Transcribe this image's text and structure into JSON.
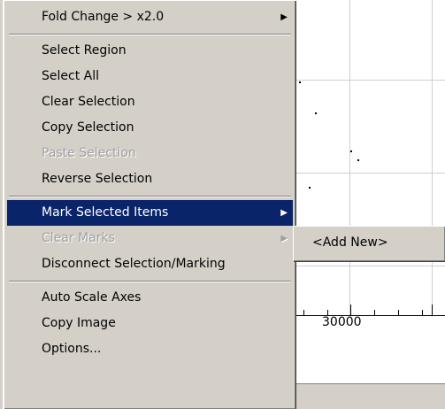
{
  "menu": {
    "items": [
      {
        "label": "Fold Change > x2.0",
        "has_submenu": true,
        "disabled": false
      },
      {
        "separator": true
      },
      {
        "label": "Select Region",
        "disabled": false
      },
      {
        "label": "Select All",
        "disabled": false
      },
      {
        "label": "Clear Selection",
        "disabled": false
      },
      {
        "label": "Copy Selection",
        "disabled": false
      },
      {
        "label": "Paste Selection",
        "disabled": true
      },
      {
        "label": "Reverse Selection",
        "disabled": false
      },
      {
        "separator": true
      },
      {
        "label": "Mark Selected Items",
        "has_submenu": true,
        "selected": true
      },
      {
        "label": "Clear Marks",
        "has_submenu": true,
        "disabled": true
      },
      {
        "label": "Disconnect Selection/Marking",
        "disabled": false
      },
      {
        "separator": true
      },
      {
        "label": "Auto Scale Axes",
        "disabled": false
      },
      {
        "label": "Copy Image",
        "disabled": false
      },
      {
        "label": "Options...",
        "disabled": false
      }
    ]
  },
  "submenu": {
    "items": [
      {
        "label": "<Add New>"
      }
    ]
  },
  "plot": {
    "x_tick_label": "30000"
  },
  "colors": {
    "menu_bg": "#d4d0c8",
    "highlight": "#0a246a",
    "disabled_text": "#a0a0a0"
  },
  "icons": {
    "submenu_arrow": "submenu-arrow-icon"
  }
}
